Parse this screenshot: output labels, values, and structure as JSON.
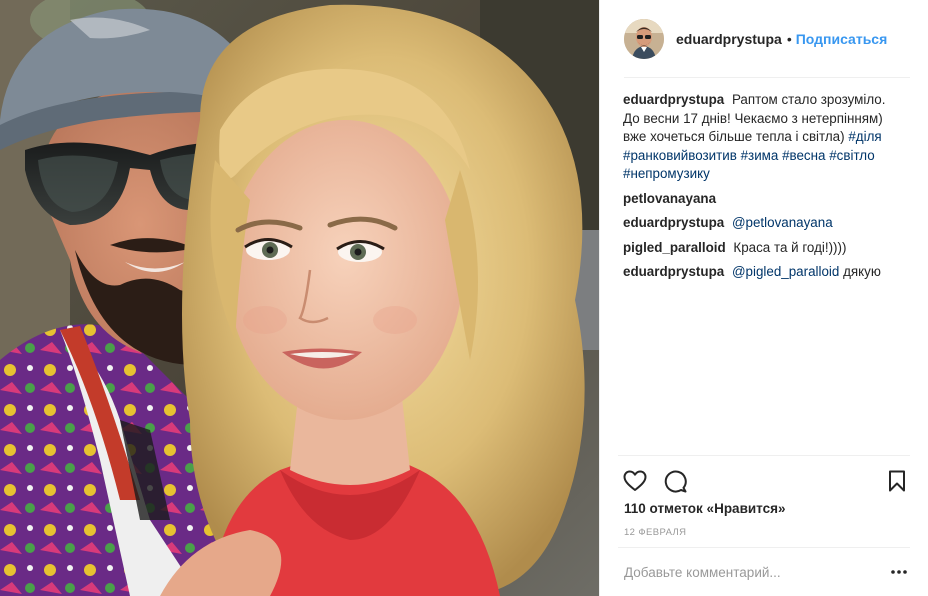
{
  "post": {
    "author": "eduardprystupa",
    "separator": "•",
    "follow_label": "Подписаться"
  },
  "comments": [
    {
      "user": "eduardprystupa",
      "text": "Раптом стало зрозуміло. До весни 17 днів! Чекаємо з нетерпінням) вже хочеться більше тепла і світла)",
      "hashtags": [
        "#діля",
        "#ранковийвозитив",
        "#зима",
        "#весна",
        "#світло",
        "#непромузику"
      ]
    },
    {
      "user": "petlovanayana",
      "text": ""
    },
    {
      "user": "eduardprystupa",
      "mention": "@petlovanayana",
      "text": ""
    },
    {
      "user": "pigled_paralloid",
      "text": "Краса та й годі!))))"
    },
    {
      "user": "eduardprystupa",
      "mention": "@pigled_paralloid",
      "text": "дякую"
    }
  ],
  "actions": {
    "like_icon": "heart-icon",
    "comment_icon": "comment-bubble-icon",
    "save_icon": "bookmark-icon",
    "likes_text": "110 отметок «Нравится»"
  },
  "date": "12 февраля",
  "add_comment": {
    "placeholder": "Добавьте комментарий...",
    "more_icon": "more-options-icon"
  },
  "colors": {
    "link_blue": "#3897f0",
    "hashtag_navy": "#003569",
    "text": "#262626",
    "muted": "#999999",
    "divider": "#efefef"
  }
}
